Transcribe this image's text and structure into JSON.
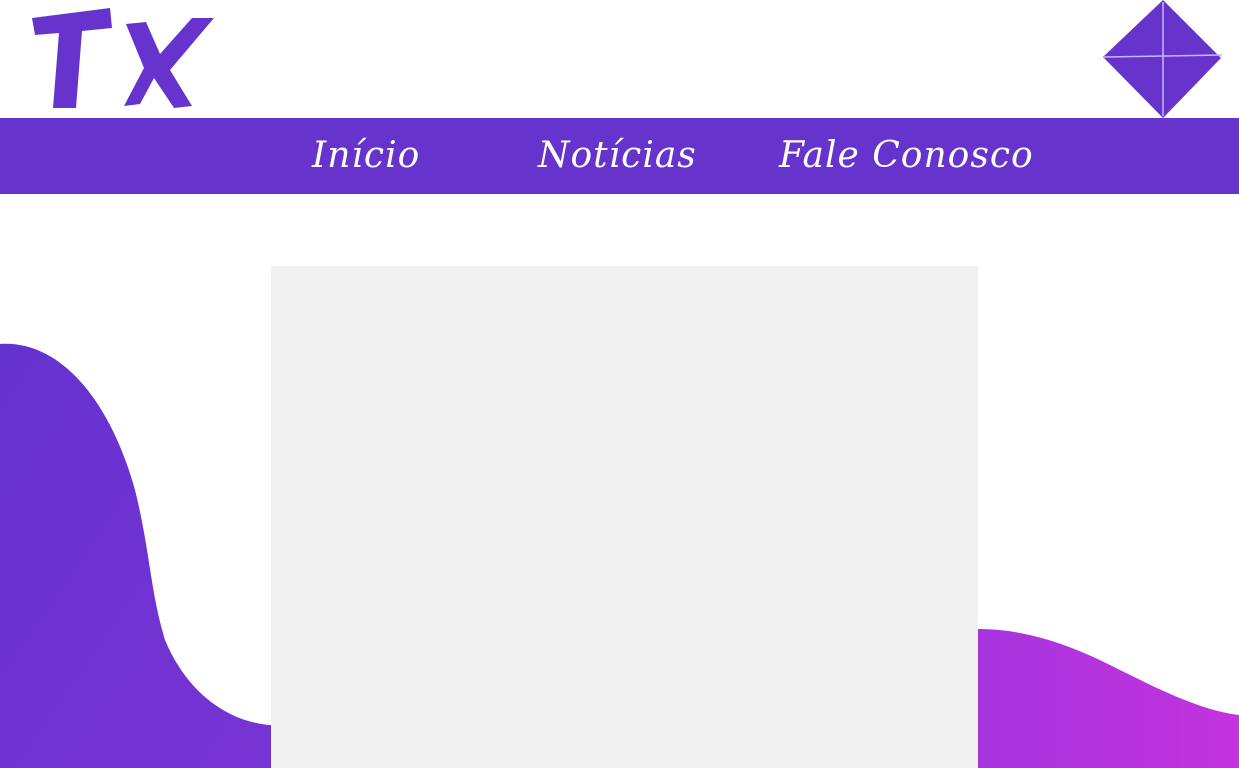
{
  "header": {
    "logo_text": "TX",
    "menu_icon": "diamond-menu-icon"
  },
  "nav": {
    "items": [
      {
        "label": "Início"
      },
      {
        "label": "Notícias"
      },
      {
        "label": "Fale Conosco"
      }
    ]
  },
  "colors": {
    "accent": "#6634cc",
    "wave_left_start": "#6a30cf",
    "wave_left_end": "#7a32d2",
    "wave_right_start": "#a934e0",
    "wave_right_end": "#c233df",
    "panel": "#f0f0f0"
  },
  "main": {
    "content_panel": ""
  }
}
